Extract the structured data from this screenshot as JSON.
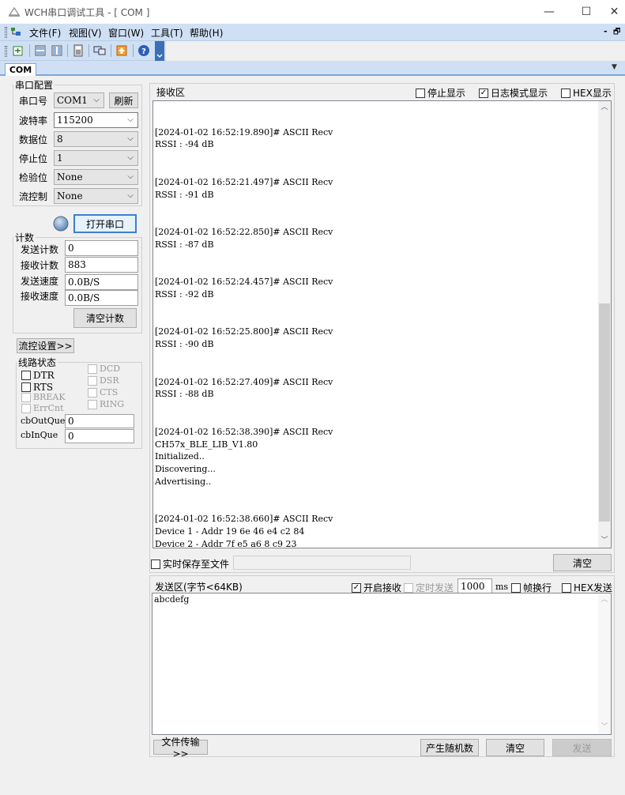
{
  "window": {
    "title": "WCH串口调试工具 - [ COM ]",
    "minimize": "—",
    "maximize": "☐",
    "close": "✕"
  },
  "menu": {
    "items": [
      "文件(F)",
      "视图(V)",
      "窗口(W)",
      "工具(T)",
      "帮助(H)"
    ],
    "mdi_minimize": "-",
    "mdi_restore": "🗗"
  },
  "tabs": {
    "active": "COM"
  },
  "serial_config": {
    "legend": "串口配置",
    "port_label": "串口号",
    "port_value": "COM1",
    "refresh_label": "刷新",
    "baud_label": "波特率",
    "baud_value": "115200",
    "databits_label": "数据位",
    "databits_value": "8",
    "stopbits_label": "停止位",
    "stopbits_value": "1",
    "parity_label": "检验位",
    "parity_value": "None",
    "flow_label": "流控制",
    "flow_value": "None",
    "open_port_label": "打开串口"
  },
  "counters": {
    "legend": "计数",
    "send_count_label": "发送计数",
    "send_count_value": "0",
    "recv_count_label": "接收计数",
    "recv_count_value": "883",
    "send_speed_label": "发送速度",
    "send_speed_value": "0.0B/S",
    "recv_speed_label": "接收速度",
    "recv_speed_value": "0.0B/S",
    "clear_label": "清空计数"
  },
  "flow_settings_label": "流控设置>>",
  "line_status": {
    "legend": "线路状态",
    "dtr": "DTR",
    "rts": "RTS",
    "break": "BREAK",
    "errcnt": "ErrCnt",
    "dcd": "DCD",
    "dsr": "DSR",
    "cts": "CTS",
    "ring": "RING",
    "cbout_label": "cbOutQue",
    "cbout_value": "0",
    "cbin_label": "cbInQue",
    "cbin_value": "0"
  },
  "receive": {
    "legend": "接收区",
    "stop_display": "停止显示",
    "log_mode": "日志模式显示",
    "hex_display": "HEX显示",
    "text": "\n\n[2024-01-02 16:52:19.890]# ASCII Recv\nRSSI : -94 dB\n\n\n[2024-01-02 16:52:21.497]# ASCII Recv\nRSSI : -91 dB\n\n\n[2024-01-02 16:52:22.850]# ASCII Recv\nRSSI : -87 dB\n\n\n[2024-01-02 16:52:24.457]# ASCII Recv\nRSSI : -92 dB\n\n\n[2024-01-02 16:52:25.800]# ASCII Recv\nRSSI : -90 dB\n\n\n[2024-01-02 16:52:27.409]# ASCII Recv\nRSSI : -88 dB\n\n\n[2024-01-02 16:52:38.390]# ASCII Recv\nCH57x_BLE_LIB_V1.80\nInitialized..\nDiscovering...\nAdvertising..\n\n\n[2024-01-02 16:52:38.660]# ASCII Recv\nDevice 1 - Addr 19 6e 46 e4 c2 84\nDevice 2 - Addr 7f e5 a6 8 c9 23",
    "realtime_save": "实时保存至文件",
    "clear_label": "清空"
  },
  "send": {
    "legend": "发送区(字节<64KB)",
    "enable_recv": "开启接收",
    "timed_send": "定时发送",
    "interval_value": "1000",
    "interval_unit": "ms",
    "newline": "帧换行",
    "hex_send": "HEX发送",
    "text": "abcdefg",
    "file_transfer": "文件传输>>",
    "random": "产生随机数",
    "clear_label": "清空",
    "send_label": "发送"
  },
  "colors": {
    "menubar": "#cfe0f5",
    "tab_accent": "#7aa7dd",
    "focus": "#3c7fd1"
  }
}
